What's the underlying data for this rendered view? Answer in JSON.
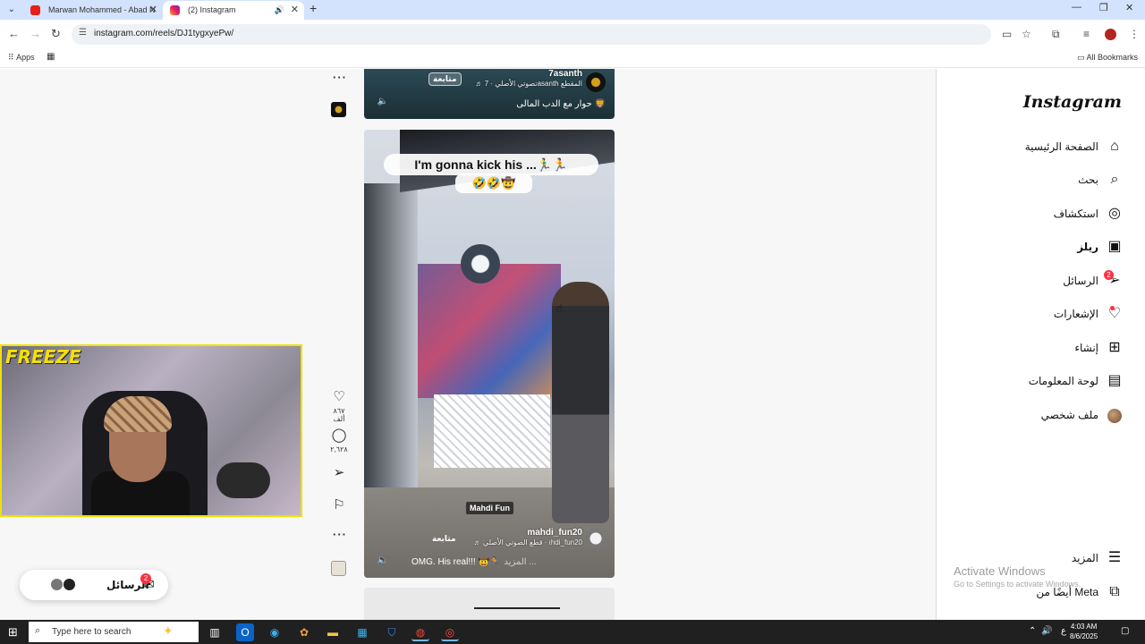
{
  "browser": {
    "tabs": [
      {
        "title": "Marwan Mohammed - Abad N",
        "active": false
      },
      {
        "title": "(2) Instagram",
        "active": true
      }
    ],
    "url": "instagram.com/reels/DJ1tygxyePw/",
    "bookmarks": {
      "apps_label": "Apps",
      "all_bookmarks_label": "All Bookmarks"
    }
  },
  "sidebar": {
    "logo": "Instagram",
    "items": [
      {
        "label": "الصفحة الرئيسية",
        "icon": "home-icon"
      },
      {
        "label": "بحث",
        "icon": "search-icon"
      },
      {
        "label": "استكشاف",
        "icon": "compass-icon"
      },
      {
        "label": "ريلز",
        "icon": "reels-icon"
      },
      {
        "label": "الرسائل",
        "icon": "messenger-icon",
        "badge": "2"
      },
      {
        "label": "الإشعارات",
        "icon": "heart-icon"
      },
      {
        "label": "إنشاء",
        "icon": "plus-square-icon"
      },
      {
        "label": "لوحة المعلومات",
        "icon": "dashboard-icon"
      },
      {
        "label": "ملف شخصي",
        "icon": "avatar"
      }
    ],
    "more_label": "المزيد",
    "also_from_meta": "أيضًا من Meta"
  },
  "windows_watermark": {
    "title": "Activate Windows",
    "subtitle": "Go to Settings to activate Windows."
  },
  "reels": {
    "top": {
      "username": "7asanth",
      "follow": "متابعة",
      "audio": "♬ تصوتي الأصلي · 7asanth المقطع",
      "caption": "حوار مع الدب المالى 🦁"
    },
    "main": {
      "overlay_text": "I'm gonna kick his ...🏃‍♂️🏃",
      "overlay_emoji": "🤣🤣🤠",
      "watermark": "Mahdi Fun",
      "username": "mahdi_fun20",
      "follow": "متابعة",
      "audio": "♬ قطع الصوتي الأصلي · ıhdi_fun20",
      "caption": "OMG. His real!!! 🤠🏃",
      "more": "المزيد ..."
    }
  },
  "actions": {
    "likes": "٨٦٧ ألف",
    "comments": "٢,٦٢٨"
  },
  "messages_pill": {
    "label": "الرسائل",
    "badge": "2"
  },
  "webcam": {
    "overlay_text": "FREEZE"
  },
  "taskbar": {
    "search_placeholder": "Type here to search",
    "time": "4:03 AM",
    "date": "8/6/2025",
    "lang": "ع"
  }
}
